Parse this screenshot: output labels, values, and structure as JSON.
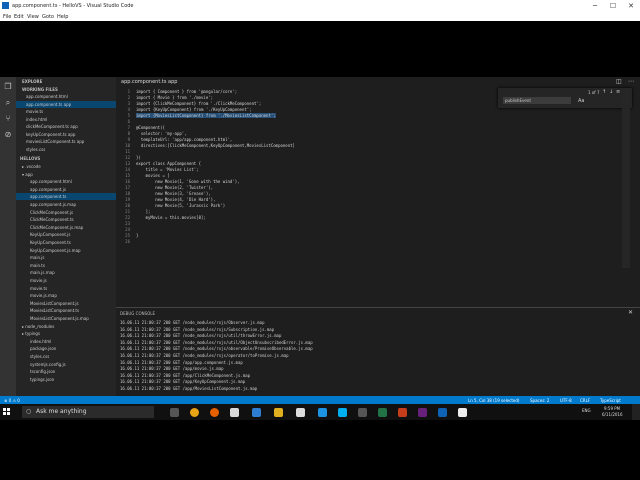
{
  "titlebar": {
    "title": "app.component.ts - HelloVS - Visual Studio Code",
    "minimize": "─",
    "maximize": "☐",
    "close": "✕"
  },
  "menu": [
    "File",
    "Edit",
    "View",
    "Goto",
    "Help"
  ],
  "sidebar": {
    "explore": "EXPLORE",
    "working_files": "WORKING FILES",
    "working": [
      {
        "label": "app.component.html"
      },
      {
        "label": "app.component.ts  app"
      },
      {
        "label": "movie.ts"
      },
      {
        "label": "index.html"
      },
      {
        "label": "clickMeComponent.ts  app"
      },
      {
        "label": "keyUpComponent.ts  app"
      },
      {
        "label": "moviesListComponent.ts  app"
      },
      {
        "label": "styles.css"
      }
    ],
    "project": "HELLOVS",
    "files": [
      {
        "label": "▸ .vscode"
      },
      {
        "label": "▾ app"
      },
      {
        "label": "app.component.html"
      },
      {
        "label": "app.component.js"
      },
      {
        "label": "app.component.ts"
      },
      {
        "label": "app.component.js.map"
      },
      {
        "label": "ClickMeComponent.js"
      },
      {
        "label": "ClickMeComponent.ts"
      },
      {
        "label": "ClickMeComponent.js.map"
      },
      {
        "label": "KeyUpComponent.js"
      },
      {
        "label": "KeyUpComponent.ts"
      },
      {
        "label": "KeyUpComponent.js.map"
      },
      {
        "label": "main.js"
      },
      {
        "label": "main.ts"
      },
      {
        "label": "main.js.map"
      },
      {
        "label": "movie.js"
      },
      {
        "label": "movie.ts"
      },
      {
        "label": "movie.js.map"
      },
      {
        "label": "MoviesListComponent.js"
      },
      {
        "label": "MoviesListComponent.ts"
      },
      {
        "label": "MoviesListComponent.js.map"
      },
      {
        "label": "▸ node_modules"
      },
      {
        "label": "▸ typings"
      },
      {
        "label": "index.html"
      },
      {
        "label": "package.json"
      },
      {
        "label": "styles.css"
      },
      {
        "label": "systemjs.config.js"
      },
      {
        "label": "tsconfig.json"
      },
      {
        "label": "typings.json"
      }
    ]
  },
  "editor": {
    "tab": "app.component.ts  app",
    "lines": [
      "import { Component } from '@angular/core';",
      "import { Movie } from './movie';",
      "import {ClickMeComponent} from './ClickMeComponent';",
      "import {KeyUpComponent} from './KeyUpComponent';",
      "import {MoviesListComponent} from './MoviesListComponent';",
      "",
      "@Component({",
      "  selector: 'my-app',",
      "  templateUrl: 'app/app.component.html',",
      "  directives:[ClickMeComponent,KeyUpComponent,MoviesListComponent]",
      "",
      "})",
      "export class AppComponent {",
      "    title = 'Movies List';",
      "    movies = [",
      "        new Movie(1, 'Gone with the wind'),",
      "        new Movie(2, 'Twister'),",
      "        new Movie(3, 'Grease'),",
      "        new Movie(4, 'Die Hard'),",
      "        new Movie(5, 'Jurassic Park')",
      "    ];",
      "    myMovie = this.movies[0];",
      "",
      "",
      "}",
      ""
    ]
  },
  "find": {
    "value": "publishEvent",
    "count": "1 of 7",
    "prev": "↑",
    "next": "↓",
    "selection": "≡",
    "close": "✕"
  },
  "panel": {
    "title": "DEBUG CONSOLE",
    "lines": [
      "16.06.11 21:00:37 200 GET /node_modules/rxjs/Observer.js.map",
      "16.06.11 21:00:37 200 GET /node_modules/rxjs/Subscription.js.map",
      "16.06.11 21:00:37 200 GET /node_modules/rxjs/util/throwError.js.map",
      "16.06.11 21:00:37 200 GET /node_modules/rxjs/util/ObjectUnsubscribedError.js.map",
      "16.06.11 21:00:37 200 GET /node_modules/rxjs/observable/PromiseObservable.js.map",
      "16.06.11 21:00:37 200 GET /node_modules/rxjs/operator/toPromise.js.map",
      "16.06.11 21:00:37 200 GET /app/app.component.js.map",
      "16.06.11 21:00:37 200 GET /app/movie.js.map",
      "16.06.11 21:00:37 200 GET /app/ClickMeComponent.js.map",
      "16.06.11 21:00:37 200 GET /app/KeyUpComponent.js.map",
      "16.06.11 21:00:37 200 GET /app/MoviesListComponent.js.map"
    ]
  },
  "status": {
    "left": "⊗ 0  ⚠ 0",
    "position": "Ln 5, Col 38 (19 selected)",
    "indent": "Spaces: 2",
    "encoding": "UTF-8",
    "eol": "CRLF",
    "language": "TypeScript"
  },
  "taskbar": {
    "search_placeholder": "Ask me anything",
    "time": "9:59 PM",
    "date": "6/11/2016",
    "lang": "ENG"
  },
  "colors": {
    "accent": "#007acc",
    "editor_bg": "#1e1e1e",
    "sidebar_bg": "#252526"
  }
}
